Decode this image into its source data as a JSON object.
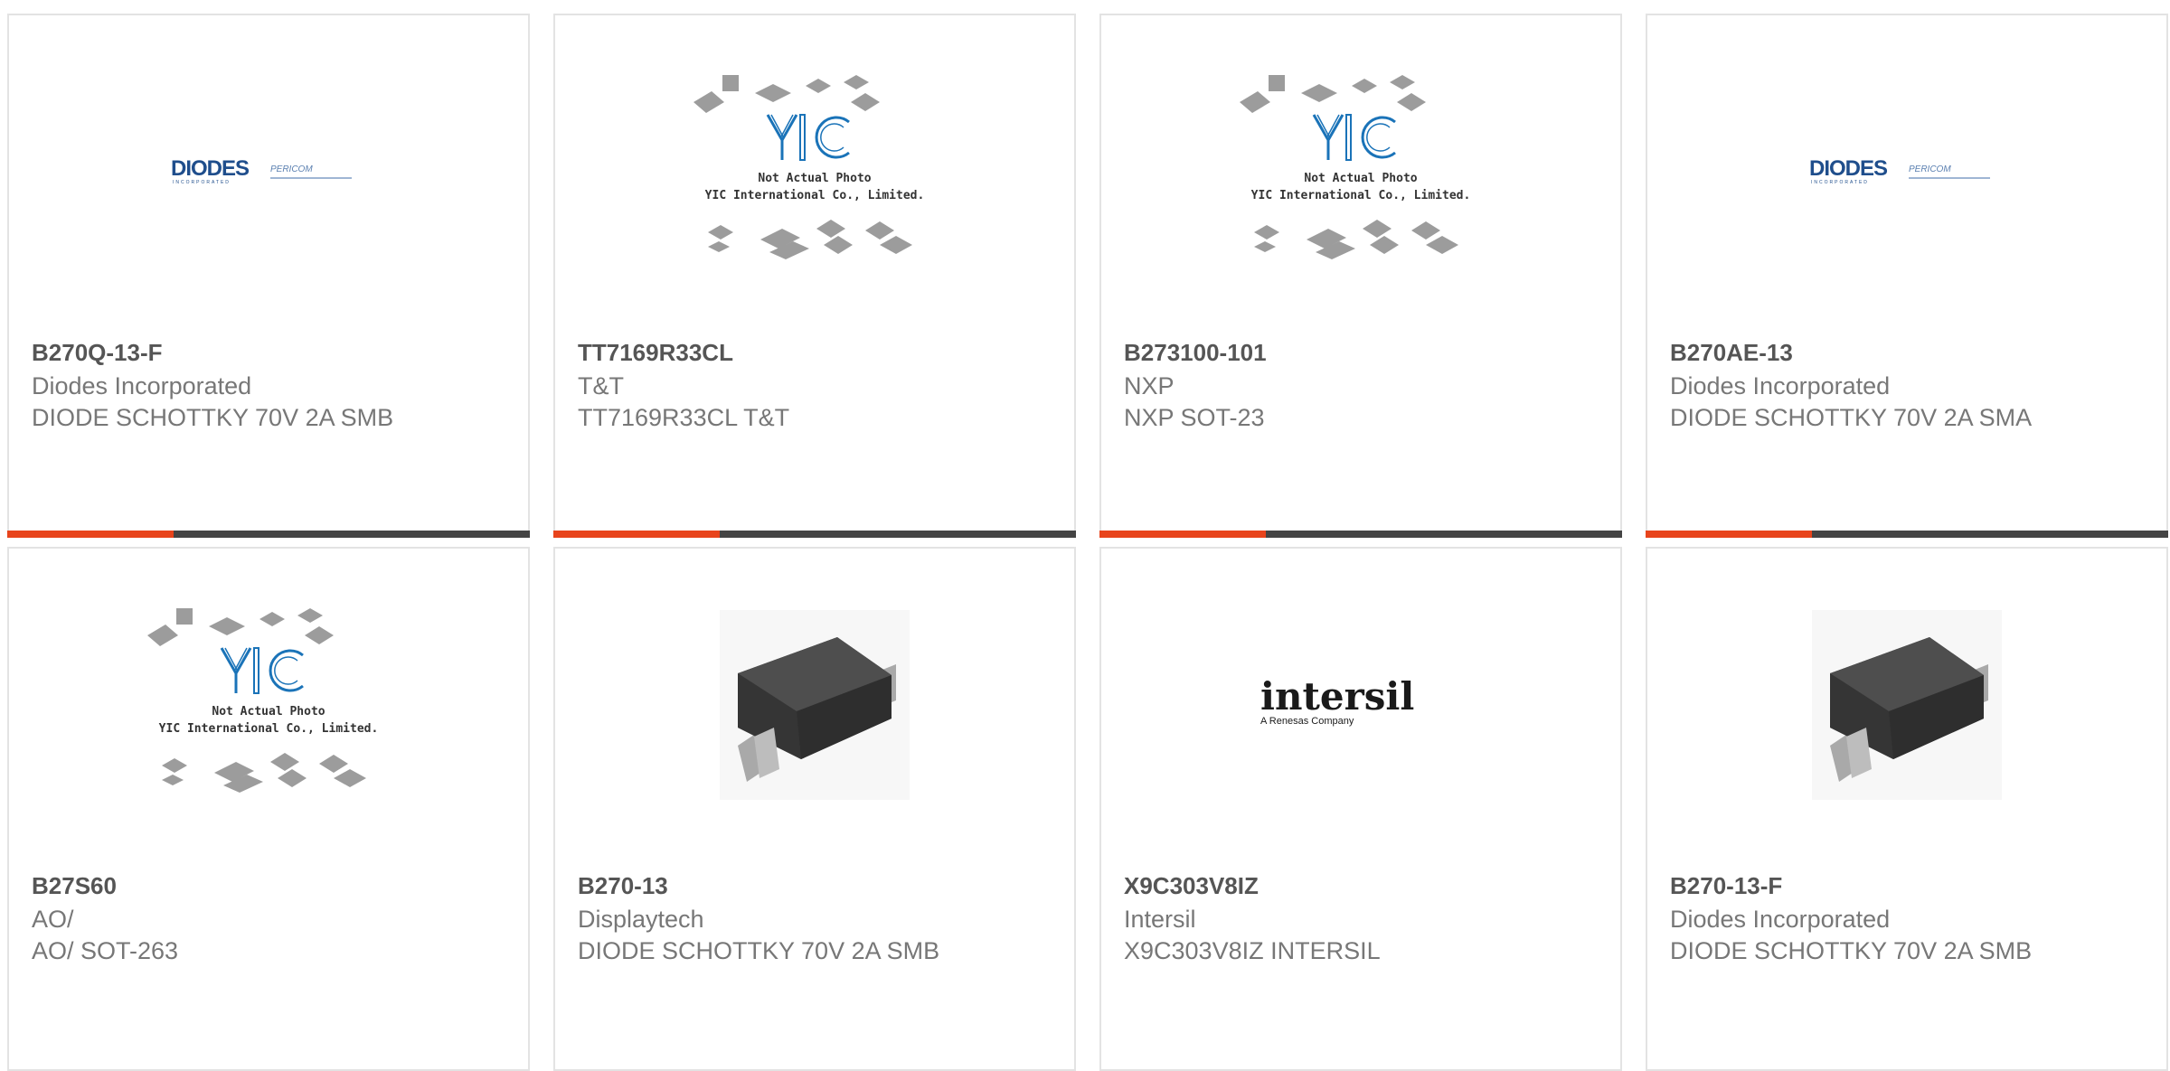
{
  "colors": {
    "accent": "#e8441c",
    "bar": "#444444",
    "border": "#e3e3e3",
    "part_number_text": "#555555",
    "body_text": "#777777"
  },
  "products": [
    {
      "part_number": "B270Q-13-F",
      "manufacturer": "Diodes Incorporated",
      "description": "DIODE SCHOTTKY 70V 2A SMB",
      "image": "diodes-pericom-logo",
      "logo_main": "DIODES",
      "logo_sub": "INCORPORATED",
      "logo_secondary": "PERICOM"
    },
    {
      "part_number": "TT7169R33CL",
      "manufacturer": "T&T",
      "description": "TT7169R33CL T&T",
      "image": "yic-placeholder",
      "logo": "YIC",
      "line1": "Not Actual Photo",
      "line2": "YIC International Co., Limited."
    },
    {
      "part_number": "B273100-101",
      "manufacturer": "NXP",
      "description": "NXP SOT-23",
      "image": "yic-placeholder",
      "logo": "YIC",
      "line1": "Not Actual Photo",
      "line2": "YIC International Co., Limited."
    },
    {
      "part_number": "B270AE-13",
      "manufacturer": "Diodes Incorporated",
      "description": "DIODE SCHOTTKY 70V 2A SMA",
      "image": "diodes-pericom-logo",
      "logo_main": "DIODES",
      "logo_sub": "INCORPORATED",
      "logo_secondary": "PERICOM"
    },
    {
      "part_number": "B27S60",
      "manufacturer": "AO/",
      "description": "AO/ SOT-263",
      "image": "yic-placeholder",
      "logo": "YIC",
      "line1": "Not Actual Photo",
      "line2": "YIC International Co., Limited."
    },
    {
      "part_number": "B270-13",
      "manufacturer": "Displaytech",
      "description": "DIODE SCHOTTKY 70V 2A SMB",
      "image": "smb-package-photo"
    },
    {
      "part_number": "X9C303V8IZ",
      "manufacturer": "Intersil",
      "description": "X9C303V8IZ INTERSIL",
      "image": "intersil-logo",
      "logo_main": "intersil",
      "logo_sub": "A Renesas Company"
    },
    {
      "part_number": "B270-13-F",
      "manufacturer": "Diodes Incorporated",
      "description": "DIODE SCHOTTKY 70V 2A SMB",
      "image": "smb-package-photo"
    }
  ]
}
